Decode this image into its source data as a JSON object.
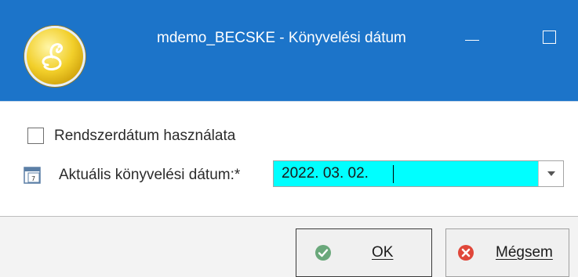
{
  "window": {
    "title": "mdemo_BECSKE - Könyvelési dátum",
    "minimize_icon": "minimize-icon",
    "maximize_icon": "maximize-icon",
    "titlebar_color": "#1c74c9"
  },
  "form": {
    "use_system_date": {
      "label": "Rendszerdátum használata",
      "checked": false
    },
    "posting_date": {
      "label": "Aktuális könyvelési dátum:*",
      "value": "2022. 03. 02.",
      "field_color": "#00ffff",
      "icon": "calendar-icon"
    }
  },
  "buttons": {
    "ok": {
      "label": "OK",
      "icon": "check-circle-icon",
      "icon_color": "#6aa87b"
    },
    "cancel": {
      "label": "Mégsem",
      "icon": "close-circle-icon",
      "icon_color": "#e0473a"
    }
  }
}
